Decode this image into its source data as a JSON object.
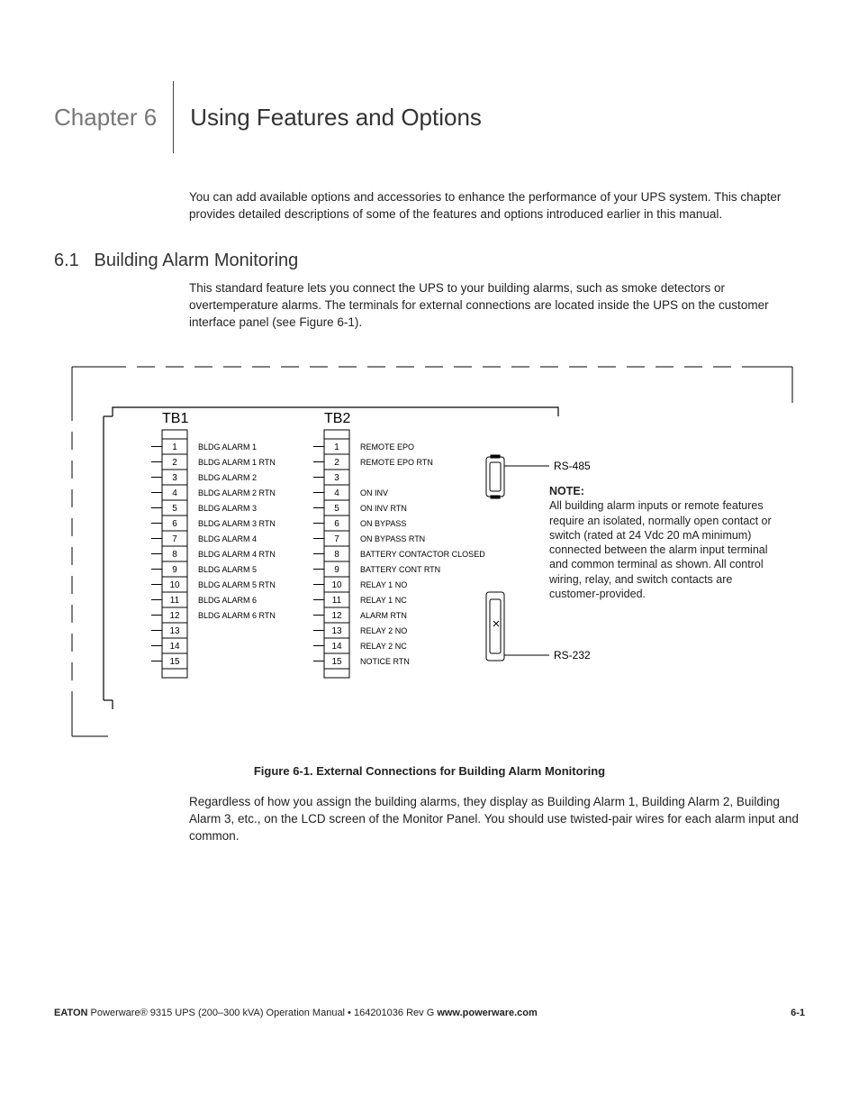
{
  "chapter": {
    "num": "Chapter 6",
    "title": "Using Features and Options"
  },
  "intro": "You can add available options and accessories to enhance the performance of your UPS system. This chapter provides detailed descriptions of some of the features and options introduced earlier in this manual.",
  "section": {
    "num": "6.1",
    "title": "Building Alarm Monitoring",
    "text": "This standard feature lets you connect the UPS to your building alarms, such as smoke detectors or overtemperature alarms. The terminals for external connections are located inside the UPS on the customer interface panel (see Figure 6-1)."
  },
  "figure": {
    "caption": "Figure 6-1. External Connections for Building Alarm Monitoring",
    "tb1_label": "TB1",
    "tb2_label": "TB2",
    "note_heading": "NOTE:",
    "note_body": "All building alarm inputs or remote features require an isolated, normally open contact or switch (rated at 24 Vdc 20 mA minimum) connected between the alarm input terminal and common terminal as shown. All control wiring, relay, and switch contacts are customer-provided.",
    "rs485": "RS-485",
    "rs232": "RS-232",
    "tb1": [
      {
        "n": "1",
        "label": "BLDG ALARM 1"
      },
      {
        "n": "2",
        "label": "BLDG ALARM 1 RTN"
      },
      {
        "n": "3",
        "label": "BLDG ALARM 2"
      },
      {
        "n": "4",
        "label": "BLDG ALARM 2 RTN"
      },
      {
        "n": "5",
        "label": "BLDG ALARM 3"
      },
      {
        "n": "6",
        "label": "BLDG ALARM 3 RTN"
      },
      {
        "n": "7",
        "label": "BLDG ALARM 4"
      },
      {
        "n": "8",
        "label": "BLDG ALARM 4 RTN"
      },
      {
        "n": "9",
        "label": "BLDG ALARM 5"
      },
      {
        "n": "10",
        "label": "BLDG ALARM 5 RTN"
      },
      {
        "n": "11",
        "label": "BLDG ALARM 6"
      },
      {
        "n": "12",
        "label": "BLDG ALARM 6 RTN"
      },
      {
        "n": "13",
        "label": ""
      },
      {
        "n": "14",
        "label": ""
      },
      {
        "n": "15",
        "label": ""
      }
    ],
    "tb2": [
      {
        "n": "1",
        "label": "REMOTE EPO"
      },
      {
        "n": "2",
        "label": "REMOTE EPO RTN"
      },
      {
        "n": "3",
        "label": ""
      },
      {
        "n": "4",
        "label": "ON INV"
      },
      {
        "n": "5",
        "label": "ON INV RTN"
      },
      {
        "n": "6",
        "label": "ON BYPASS"
      },
      {
        "n": "7",
        "label": "ON BYPASS RTN"
      },
      {
        "n": "8",
        "label": "BATTERY CONTACTOR CLOSED"
      },
      {
        "n": "9",
        "label": "BATTERY CONT RTN"
      },
      {
        "n": "10",
        "label": "RELAY 1 NO"
      },
      {
        "n": "11",
        "label": "RELAY 1 NC"
      },
      {
        "n": "12",
        "label": "ALARM RTN"
      },
      {
        "n": "13",
        "label": "RELAY 2 NO"
      },
      {
        "n": "14",
        "label": "RELAY 2 NC"
      },
      {
        "n": "15",
        "label": "NOTICE RTN"
      }
    ]
  },
  "after_figure": "Regardless of how you assign the building alarms, they display as Building Alarm 1, Building Alarm 2, Building Alarm 3, etc., on the LCD screen of the Monitor Panel. You should use twisted-pair wires for each alarm input and common.",
  "footer": {
    "brand": "EATON",
    "product": " Powerware® 9315 UPS (200–300 kVA) Operation Manual  •  164201036 Rev G  ",
    "url": "www.powerware.com",
    "page": "6-1"
  }
}
